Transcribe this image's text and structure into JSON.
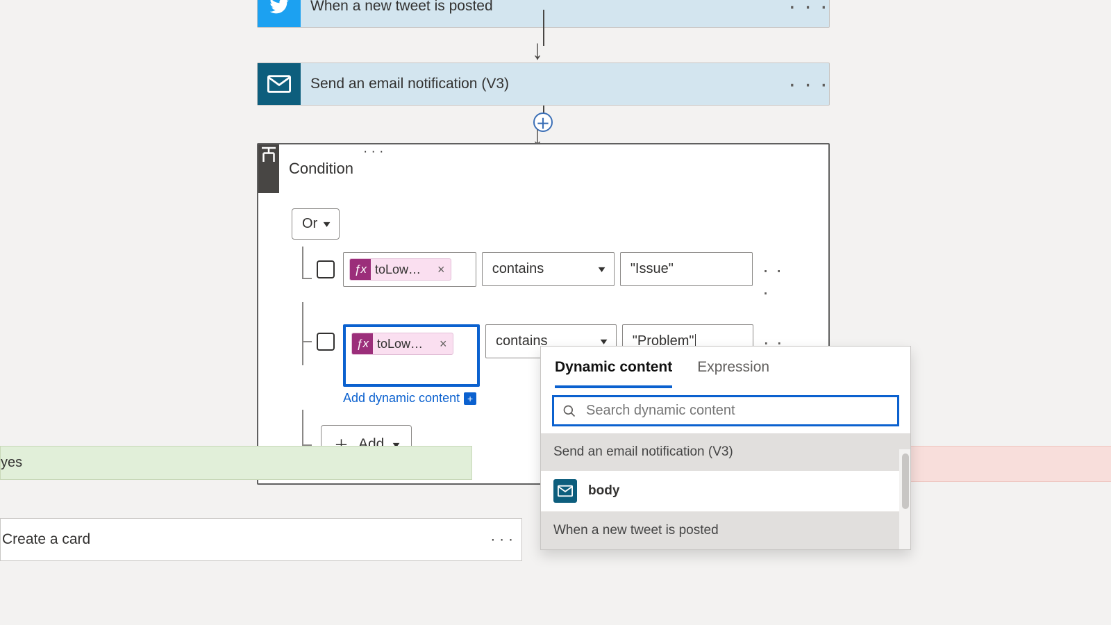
{
  "steps": {
    "twitter": {
      "title": "When a new tweet is posted"
    },
    "email": {
      "title": "Send an email notification (V3)"
    },
    "condition": {
      "title": "Condition"
    }
  },
  "condition": {
    "logic": "Or",
    "rows": [
      {
        "token": "toLower(…",
        "operator": "contains",
        "value": "\"Issue\""
      },
      {
        "token": "toLower(…",
        "operator": "contains",
        "value": "\"Problem\""
      }
    ],
    "add_dynamic_label": "Add dynamic content",
    "add_label": "Add"
  },
  "branches": {
    "yes_label": "yes",
    "create_card": "Create a card"
  },
  "flyout": {
    "tabs": {
      "dynamic": "Dynamic content",
      "expression": "Expression"
    },
    "search_placeholder": "Search dynamic content",
    "sections": [
      {
        "title": "Send an email notification (V3)",
        "items": [
          {
            "label": "body",
            "icon": "mail"
          }
        ]
      },
      {
        "title": "When a new tweet is posted",
        "items": []
      }
    ]
  },
  "ellipsis": "· · ·"
}
